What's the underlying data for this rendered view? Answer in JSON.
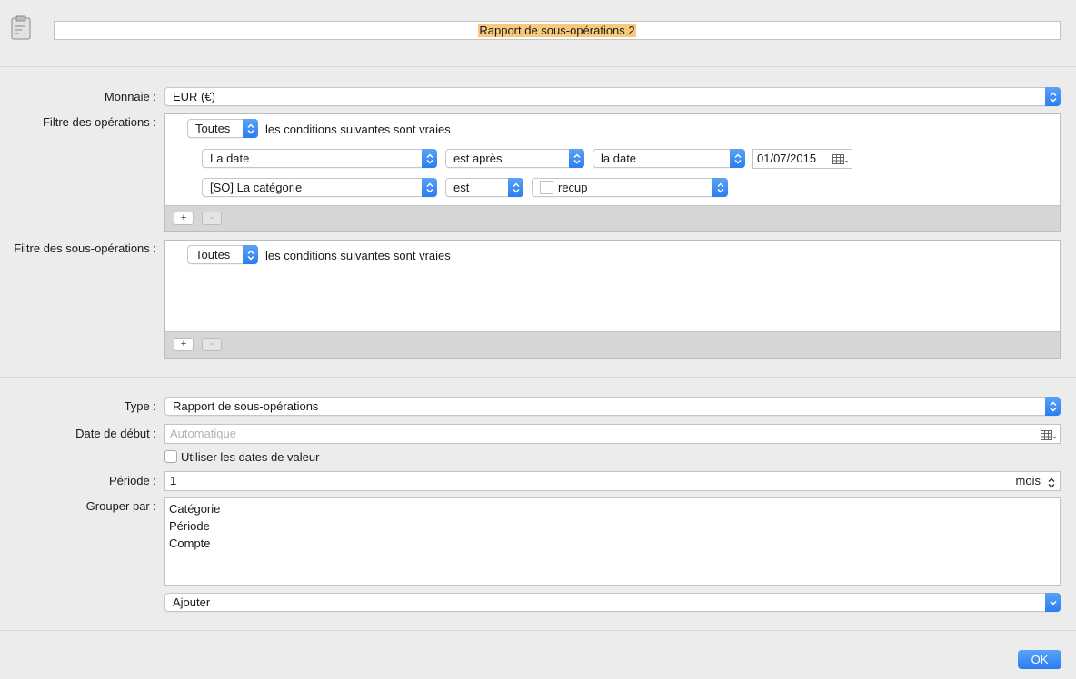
{
  "header": {
    "title": "Rapport de sous-opérations 2"
  },
  "currency": {
    "label": "Monnaie :",
    "value": "EUR (€)"
  },
  "op_filter": {
    "label": "Filtre des opérations :",
    "mode": "Toutes",
    "mode_suffix": "les conditions suivantes sont vraies",
    "rules": [
      {
        "field": "La date",
        "operator": "est après",
        "value_type": "la date",
        "value": "01/07/2015"
      },
      {
        "field": "[SO] La catégorie",
        "operator": "est",
        "value": "recup"
      }
    ],
    "add_label": "+",
    "remove_label": "-"
  },
  "subop_filter": {
    "label": "Filtre des sous-opérations :",
    "mode": "Toutes",
    "mode_suffix": "les conditions suivantes sont vraies",
    "add_label": "+",
    "remove_label": "-"
  },
  "type": {
    "label": "Type :",
    "value": "Rapport de sous-opérations"
  },
  "start_date": {
    "label": "Date de début :",
    "placeholder": "Automatique"
  },
  "value_dates": {
    "label": "Utiliser les dates de valeur"
  },
  "period": {
    "label": "Période :",
    "value": "1",
    "unit": "mois"
  },
  "group_by": {
    "label": "Grouper par :",
    "items": [
      "Catégorie",
      "Période",
      "Compte"
    ],
    "add_label": "Ajouter"
  },
  "footer": {
    "ok_label": "OK"
  },
  "icons": {
    "report": "clipboard-report-icon",
    "popup_arrows": "chevron-updown-icon",
    "calendar": "calendar-grid-icon"
  },
  "colors": {
    "accent": "#2b7ef0",
    "title_highlight": "#f7c97a"
  }
}
